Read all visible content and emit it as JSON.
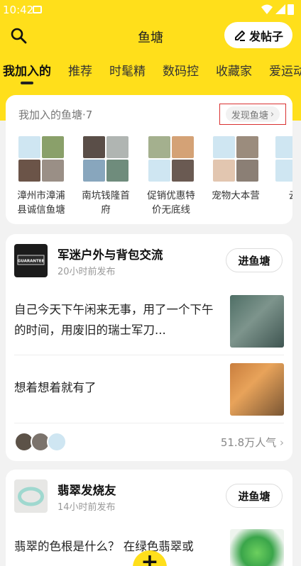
{
  "status_bar": {
    "time": "10:42"
  },
  "header": {
    "title": "鱼塘",
    "post_button_label": "发帖子"
  },
  "tabs": [
    "我加入的",
    "推荐",
    "时髦精",
    "数码控",
    "收藏家",
    "爱运动"
  ],
  "my_ponds": {
    "title": "我加入的鱼塘·7",
    "discover_label": "发现鱼塘",
    "items": [
      {
        "name": "漳州市漳浦县诚信鱼塘"
      },
      {
        "name": "南坑钱隆首府"
      },
      {
        "name": "促销优惠特价无底线"
      },
      {
        "name": "宠物大本营"
      },
      {
        "name": "云霄"
      }
    ]
  },
  "groups": [
    {
      "name": "军迷户外与背包交流",
      "time": "20小时前发布",
      "join_label": "进鱼塘",
      "avatar_text": "GUARANTEE",
      "posts": [
        {
          "text": "自己今天下午闲来无事，用了一个下午的时间，用废旧的瑞士军刀..."
        },
        {
          "text": "想着想着就有了"
        }
      ],
      "popularity": "51.8万人气"
    },
    {
      "name": "翡翠发烧友",
      "time": "14小时前发布",
      "join_label": "进鱼塘",
      "posts": [
        {
          "text": "翡翠的色根是什么？ 在绿色翡翠或"
        }
      ]
    }
  ],
  "fab_label": "+"
}
